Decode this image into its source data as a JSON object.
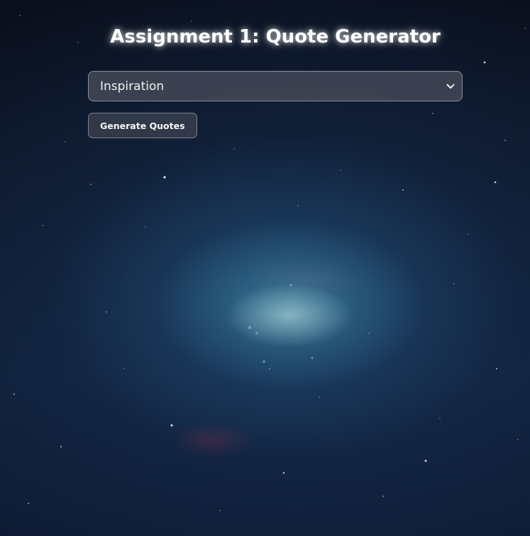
{
  "header": {
    "title": "Assignment 1: Quote Generator"
  },
  "category_select": {
    "selected": "Inspiration",
    "icon": "chevron-down-icon"
  },
  "actions": {
    "generate_label": "Generate Quotes"
  },
  "theme": {
    "background": "#0d1628",
    "nebula_accent": "#4696af",
    "control_background": "#464b58",
    "text": "#ffffff"
  }
}
